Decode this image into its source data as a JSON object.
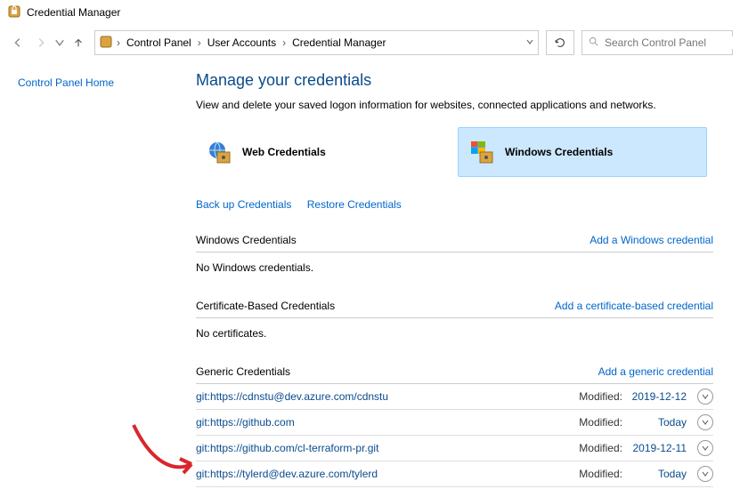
{
  "window": {
    "title": "Credential Manager"
  },
  "breadcrumb": {
    "items": [
      "Control Panel",
      "User Accounts",
      "Credential Manager"
    ]
  },
  "search": {
    "placeholder": "Search Control Panel"
  },
  "sidebar": {
    "home": "Control Panel Home"
  },
  "page": {
    "heading": "Manage your credentials",
    "subtext": "View and delete your saved logon information for websites, connected applications and networks."
  },
  "tabs": {
    "web": "Web Credentials",
    "windows": "Windows Credentials"
  },
  "links": {
    "backup": "Back up Credentials",
    "restore": "Restore Credentials"
  },
  "sections": {
    "windows": {
      "title": "Windows Credentials",
      "add": "Add a Windows credential",
      "empty": "No Windows credentials."
    },
    "cert": {
      "title": "Certificate-Based Credentials",
      "add": "Add a certificate-based credential",
      "empty": "No certificates."
    },
    "generic": {
      "title": "Generic Credentials",
      "add": "Add a generic credential"
    }
  },
  "modified_label": "Modified:",
  "generic_items": [
    {
      "name": "git:https://cdnstu@dev.azure.com/cdnstu",
      "modified": "2019-12-12"
    },
    {
      "name": "git:https://github.com",
      "modified": "Today"
    },
    {
      "name": "git:https://github.com/cl-terraform-pr.git",
      "modified": "2019-12-11"
    },
    {
      "name": "git:https://tylerd@dev.azure.com/tylerd",
      "modified": "Today"
    }
  ]
}
